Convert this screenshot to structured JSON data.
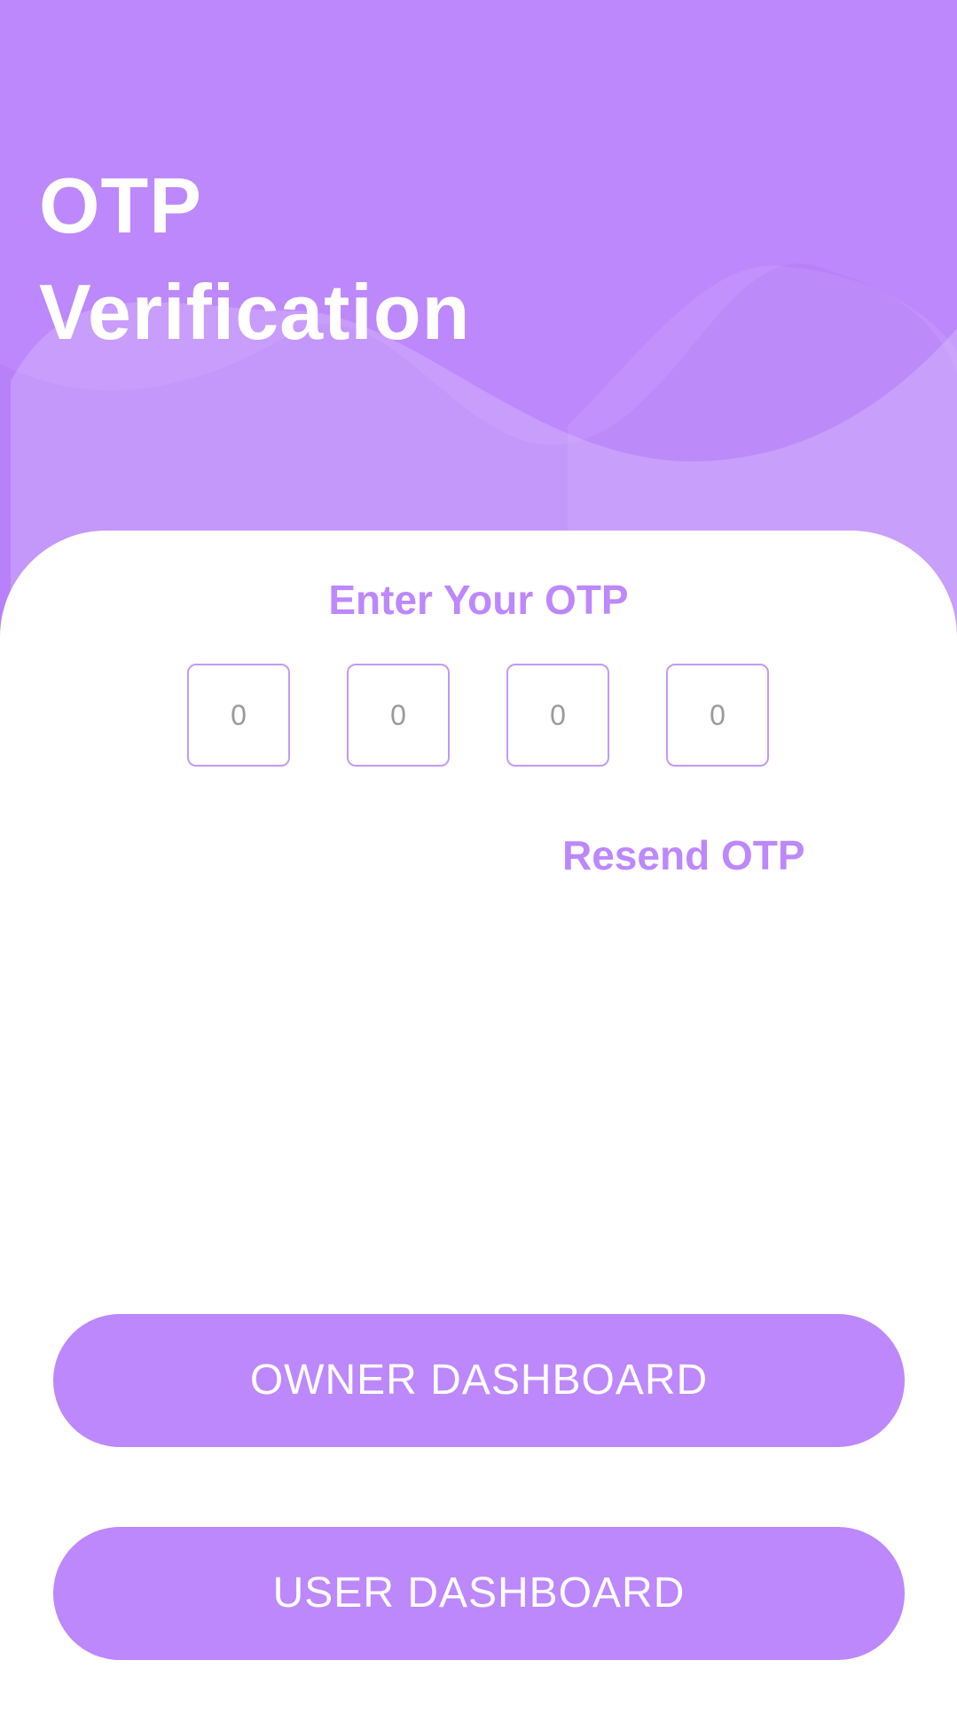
{
  "header": {
    "title_line1": "OTP",
    "title_line2": "Verification",
    "background_color": "#bd88fb"
  },
  "otp": {
    "heading": "Enter Your OTP",
    "digits": [
      {
        "placeholder": "0"
      },
      {
        "placeholder": "0"
      },
      {
        "placeholder": "0"
      },
      {
        "placeholder": "0"
      }
    ],
    "resend_label": "Resend OTP"
  },
  "buttons": {
    "owner_label": "OWNER DASHBOARD",
    "user_label": "USER DASHBOARD"
  },
  "colors": {
    "accent": "#bd88fb",
    "box_border": "#c39af5",
    "text_on_accent": "#ffffff"
  }
}
